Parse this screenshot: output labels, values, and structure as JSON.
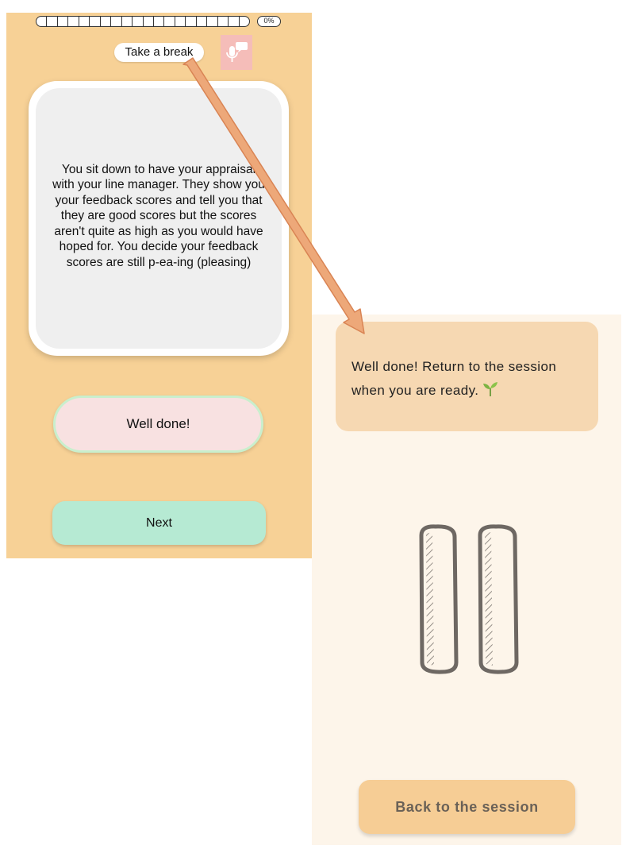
{
  "quiz": {
    "progress_percent": "0%",
    "progress_fraction": 0,
    "progress_segments": 20,
    "break_label": "Take a break",
    "voice_button_icon": "microphone-speech-icon",
    "prompt_text": "You sit down to have your appraisal with your line manager. They show you your feedback scores and tell you that they are good scores but the scores aren't quite as high as you would have hoped for.  You decide your feedback scores are still p-ea-ing (pleasing)",
    "answer_text": "Well done!",
    "next_label": "Next"
  },
  "break_screen": {
    "message": "Well done! Return to the session when you are ready.",
    "message_icon": "sprout-icon",
    "pause_icon": "pause-icon",
    "back_label": "Back to the session"
  },
  "colors": {
    "quiz_background": "#f7d196",
    "answer_background": "#f8e1e1",
    "next_button": "#b6ead3",
    "break_background": "#fdf5ea",
    "message_box": "#f6d8b2",
    "back_button": "#f6cd95",
    "annotation_arrow": "#eda879"
  }
}
